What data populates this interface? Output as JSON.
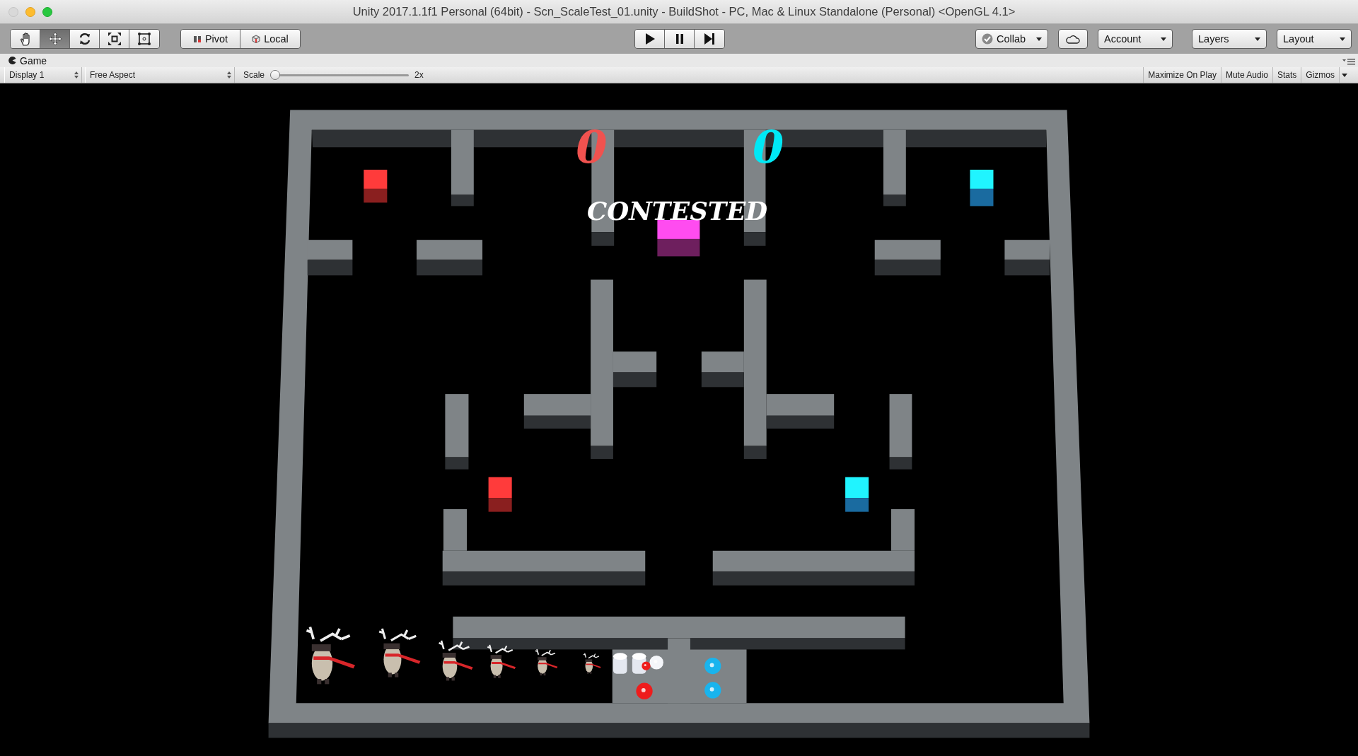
{
  "window": {
    "title": "Unity 2017.1.1f1 Personal (64bit) - Scn_ScaleTest_01.unity - BuildShot - PC, Mac & Linux Standalone (Personal) <OpenGL 4.1>"
  },
  "toolbar": {
    "tools": [
      {
        "kind": "hand",
        "selected": false
      },
      {
        "kind": "move",
        "selected": true
      },
      {
        "kind": "rotate",
        "selected": false
      },
      {
        "kind": "scale",
        "selected": false
      },
      {
        "kind": "rect",
        "selected": false
      }
    ],
    "handle_modes": [
      {
        "kind": "pivot",
        "label": "Pivot"
      },
      {
        "kind": "local",
        "label": "Local"
      }
    ],
    "playback": [
      {
        "kind": "play",
        "on": false
      },
      {
        "kind": "pause",
        "on": false
      },
      {
        "kind": "step",
        "on": false
      }
    ],
    "collab": {
      "label": "Collab"
    },
    "menus": [
      {
        "label": "Account"
      },
      {
        "label": "Layers"
      },
      {
        "label": "Layout"
      }
    ]
  },
  "game_tab": {
    "label": "Game"
  },
  "game_toolbar": {
    "display": "Display 1",
    "aspect": "Free Aspect",
    "scale_label": "Scale",
    "scale": {
      "level": 0
    },
    "scale_value": "2x",
    "toggles": [
      {
        "label": "Maximize On Play",
        "on": false
      },
      {
        "label": "Mute Audio",
        "on": false
      },
      {
        "label": "Stats",
        "on": false
      },
      {
        "label": "Gizmos",
        "on": false
      }
    ]
  },
  "game_view": {
    "scores": [
      {
        "text": "0",
        "color": "#f0524f"
      },
      {
        "text": "0",
        "color": "#00e8f5"
      }
    ],
    "status": "CONTESTED"
  }
}
